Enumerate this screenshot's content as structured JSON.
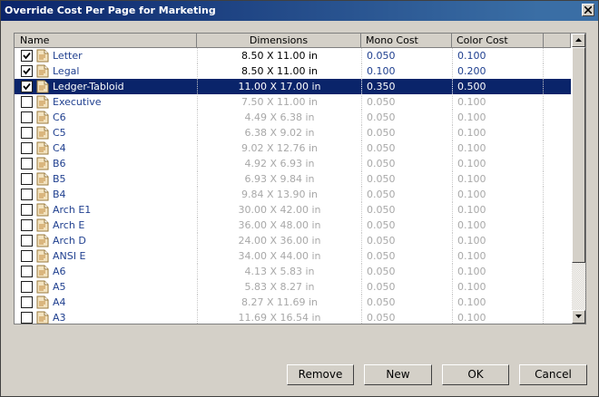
{
  "window": {
    "title": "Override Cost Per Page for Marketing"
  },
  "columns": {
    "name": "Name",
    "dimensions": "Dimensions",
    "mono": "Mono Cost",
    "color": "Color Cost"
  },
  "rows": [
    {
      "name": "Letter",
      "dim": "8.50 X 11.00 in",
      "mono": "0.050",
      "color": "0.100",
      "checked": true,
      "state": "enabled"
    },
    {
      "name": "Legal",
      "dim": "8.50 X 11.00 in",
      "mono": "0.100",
      "color": "0.200",
      "checked": true,
      "state": "enabled"
    },
    {
      "name": "Ledger-Tabloid",
      "dim": "11.00 X 17.00 in",
      "mono": "0.350",
      "color": "0.500",
      "checked": true,
      "state": "selected"
    },
    {
      "name": "Executive",
      "dim": "7.50 X 11.00 in",
      "mono": "0.050",
      "color": "0.100",
      "checked": false,
      "state": "disabled"
    },
    {
      "name": "C6",
      "dim": "4.49 X 6.38 in",
      "mono": "0.050",
      "color": "0.100",
      "checked": false,
      "state": "disabled"
    },
    {
      "name": "C5",
      "dim": "6.38 X 9.02 in",
      "mono": "0.050",
      "color": "0.100",
      "checked": false,
      "state": "disabled"
    },
    {
      "name": "C4",
      "dim": "9.02 X 12.76 in",
      "mono": "0.050",
      "color": "0.100",
      "checked": false,
      "state": "disabled"
    },
    {
      "name": "B6",
      "dim": "4.92 X 6.93 in",
      "mono": "0.050",
      "color": "0.100",
      "checked": false,
      "state": "disabled"
    },
    {
      "name": "B5",
      "dim": "6.93 X 9.84 in",
      "mono": "0.050",
      "color": "0.100",
      "checked": false,
      "state": "disabled"
    },
    {
      "name": "B4",
      "dim": "9.84 X 13.90 in",
      "mono": "0.050",
      "color": "0.100",
      "checked": false,
      "state": "disabled"
    },
    {
      "name": "Arch E1",
      "dim": "30.00 X 42.00 in",
      "mono": "0.050",
      "color": "0.100",
      "checked": false,
      "state": "disabled"
    },
    {
      "name": "Arch E",
      "dim": "36.00 X 48.00 in",
      "mono": "0.050",
      "color": "0.100",
      "checked": false,
      "state": "disabled"
    },
    {
      "name": "Arch D",
      "dim": "24.00 X 36.00 in",
      "mono": "0.050",
      "color": "0.100",
      "checked": false,
      "state": "disabled"
    },
    {
      "name": "ANSI E",
      "dim": "34.00 X 44.00 in",
      "mono": "0.050",
      "color": "0.100",
      "checked": false,
      "state": "disabled"
    },
    {
      "name": "A6",
      "dim": "4.13 X 5.83 in",
      "mono": "0.050",
      "color": "0.100",
      "checked": false,
      "state": "disabled"
    },
    {
      "name": "A5",
      "dim": "5.83 X 8.27 in",
      "mono": "0.050",
      "color": "0.100",
      "checked": false,
      "state": "disabled"
    },
    {
      "name": "A4",
      "dim": "8.27 X 11.69 in",
      "mono": "0.050",
      "color": "0.100",
      "checked": false,
      "state": "disabled"
    },
    {
      "name": "A3",
      "dim": "11.69 X 16.54 in",
      "mono": "0.050",
      "color": "0.100",
      "checked": false,
      "state": "disabled"
    }
  ],
  "buttons": {
    "remove": "Remove",
    "new": "New",
    "ok": "OK",
    "cancel": "Cancel"
  },
  "icons": {
    "row_icon": "page-icon",
    "close": "close-icon",
    "scroll_up": "arrow-up-icon",
    "scroll_down": "arrow-down-icon"
  },
  "colors": {
    "titlebar": "#0a246a",
    "selection": "#0a246a",
    "enabled_text": "#1f3f8f",
    "disabled_text": "#a8a8a8"
  }
}
